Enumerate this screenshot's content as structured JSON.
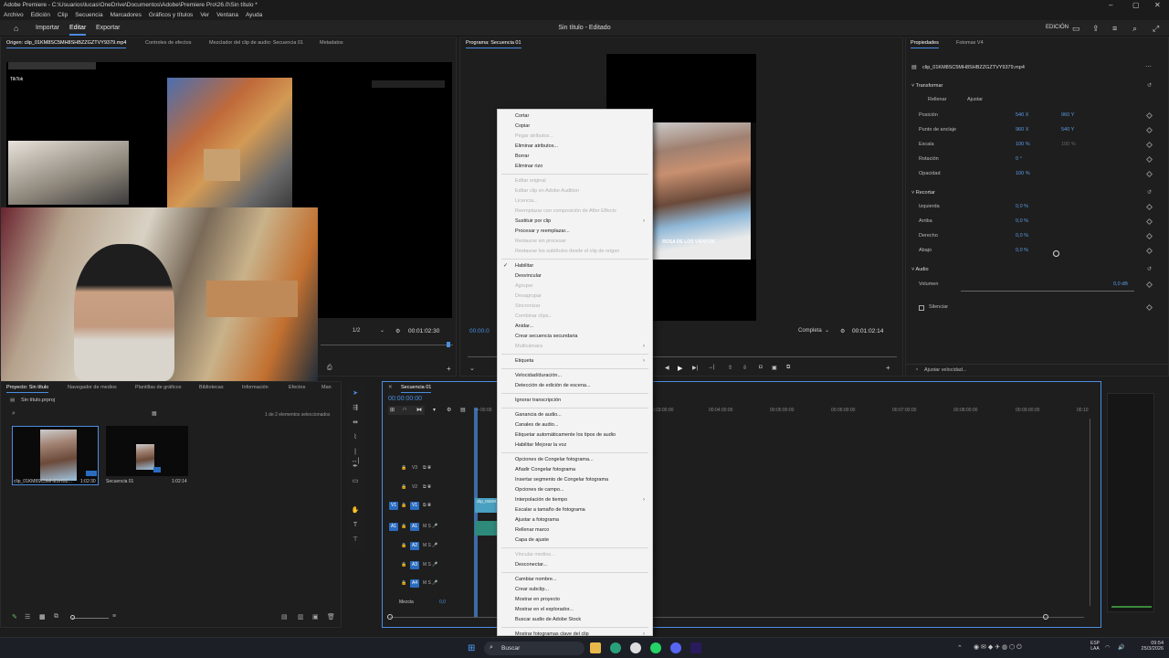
{
  "window": {
    "title": "Adobe Premiere - C:\\Usuarios\\lucas\\OneDrive\\Documentos\\Adobe\\Premiere Pro\\26.0\\Sin título *"
  },
  "menubar": [
    "Archivo",
    "Edición",
    "Clip",
    "Secuencia",
    "Marcadores",
    "Gráficos y títulos",
    "Ver",
    "Ventana",
    "Ayuda"
  ],
  "header": {
    "tabs": [
      "Importar",
      "Editar",
      "Exportar"
    ],
    "active_tab": "Editar",
    "doc_title": "Sin título - Editado",
    "workspace": "EDICIÓN"
  },
  "source_panel": {
    "tabs": [
      "Origen: clip_01KM8SC5MH8SHBZZGZTVY9379.mp4",
      "Controles de efectos",
      "Mezclador del clip de audio: Secuencia 01",
      "Metadatos"
    ],
    "fraction": "1/2",
    "timecode": "00:01:02:30"
  },
  "program_panel": {
    "tab": "Programa: Secuencia 01",
    "timecode_left": "00:00:0",
    "fit": "Completa",
    "timecode_right": "00:01:02:14",
    "frame_caption": "ROSA DE LOS VIENTOS"
  },
  "properties": {
    "tabs": [
      "Propiedades",
      "Fotomax V4"
    ],
    "clip_name": "clip_01KM8SC5MH8SHBZZGZTVY9379.mp4",
    "transform": {
      "title": "Transformar",
      "fill": "Rellenar",
      "fit": "Ajustar",
      "position_label": "Posición",
      "position_x": "540 X",
      "position_y": "960 Y",
      "anchor_label": "Punto de anclaje",
      "anchor_x": "960 X",
      "anchor_y": "540 Y",
      "scale_label": "Escala",
      "scale": "100 %",
      "scale2": "100 %",
      "rotation_label": "Rotación",
      "rotation": "0 °",
      "opacity_label": "Opacidad",
      "opacity": "100 %"
    },
    "crop": {
      "title": "Recortar",
      "left_label": "Izquierda",
      "left": "0,0 %",
      "top_label": "Arriba",
      "top": "0,0 %",
      "right_label": "Derecho",
      "right": "0,0 %",
      "bottom_label": "Abajo",
      "bottom": "0,0 %"
    },
    "audio": {
      "title": "Audio",
      "volume_label": "Volumen",
      "volume": "0,0 dB",
      "mute_label": "Silenciar",
      "volume_level": 0.55
    },
    "speed_button": "Ajustar velocidad..."
  },
  "project_panel": {
    "tabs": [
      "Proyecto: Sin título",
      "Navegador de medios",
      "Plantillas de gráficos",
      "Bibliotecas",
      "Información",
      "Efectos",
      "Man"
    ],
    "project_file": "Sin título.prproj",
    "selection_info": "1 de 2 elementos seleccionados",
    "items": [
      {
        "name": "clip_01KM8SC5MH8SHBZ...",
        "duration": "1:02:30"
      },
      {
        "name": "Secuencia 01",
        "duration": "1:02:14"
      }
    ]
  },
  "timeline": {
    "tab": "Secuencia 01",
    "timecode": "00:00:00:00",
    "ruler": [
      "00:00",
      "00:03:00:00",
      "00:04:00:00",
      "00:05:00:00",
      "00:06:00:00",
      "00:07:00:00",
      "00:08:00:00",
      "00:09:00:00",
      "00:10"
    ],
    "tracks": [
      "V3",
      "V2",
      "V1",
      "A1",
      "A2",
      "A3",
      "A4"
    ],
    "mix_label": "Mezcla",
    "mix_value": "0,0",
    "clip_label": "clip_01KM"
  },
  "context_menu": {
    "items": [
      {
        "label": "Cortar",
        "enabled": true
      },
      {
        "label": "Copiar",
        "enabled": true
      },
      {
        "label": "Pegar atributos...",
        "enabled": false
      },
      {
        "label": "Eliminar atributos...",
        "enabled": true
      },
      {
        "label": "Borrar",
        "enabled": true
      },
      {
        "label": "Eliminar rizo",
        "enabled": true
      },
      {
        "sep": true
      },
      {
        "label": "Editar original",
        "enabled": false
      },
      {
        "label": "Editar clip en Adobe Audition",
        "enabled": false
      },
      {
        "label": "Licencia...",
        "enabled": false
      },
      {
        "label": "Reemplazar con composición de After Effects",
        "enabled": false
      },
      {
        "label": "Sustituir por clip",
        "enabled": true,
        "submenu": true
      },
      {
        "label": "Procesar y reemplazar...",
        "enabled": true
      },
      {
        "label": "Restaurar sin procesar",
        "enabled": false
      },
      {
        "label": "Restaurar los subtítulos desde el clip de origen",
        "enabled": false
      },
      {
        "sep": true
      },
      {
        "label": "Habilitar",
        "enabled": true,
        "checked": true
      },
      {
        "label": "Desvincular",
        "enabled": true,
        "hover": true
      },
      {
        "label": "Agrupar",
        "enabled": false
      },
      {
        "label": "Desagrupar",
        "enabled": false
      },
      {
        "label": "Sincronizar",
        "enabled": false
      },
      {
        "label": "Combinar clips...",
        "enabled": false
      },
      {
        "label": "Anidar...",
        "enabled": true
      },
      {
        "label": "Crear secuencia secundaria",
        "enabled": true
      },
      {
        "label": "Multicámara",
        "enabled": false,
        "submenu": true
      },
      {
        "sep": true
      },
      {
        "label": "Etiqueta",
        "enabled": true,
        "submenu": true
      },
      {
        "sep": true
      },
      {
        "label": "Velocidad/duración...",
        "enabled": true
      },
      {
        "label": "Detección de edición de escena...",
        "enabled": true
      },
      {
        "sep": true
      },
      {
        "label": "Ignorar transcripción",
        "enabled": true
      },
      {
        "sep": true
      },
      {
        "label": "Ganancia de audio...",
        "enabled": true
      },
      {
        "label": "Canales de audio...",
        "enabled": true
      },
      {
        "label": "Etiquetar automáticamente los tipos de audio",
        "enabled": true
      },
      {
        "label": "Habilitar Mejorar la voz",
        "enabled": true
      },
      {
        "sep": true
      },
      {
        "label": "Opciones de Congelar fotograma...",
        "enabled": true
      },
      {
        "label": "Añadir Congelar fotograma",
        "enabled": true
      },
      {
        "label": "Insertar segmento de Congelar fotograma",
        "enabled": true
      },
      {
        "label": "Opciones de campo...",
        "enabled": true
      },
      {
        "label": "Interpolación de tiempo",
        "enabled": true,
        "submenu": true
      },
      {
        "label": "Escalar a tamaño de fotograma",
        "enabled": true
      },
      {
        "label": "Ajustar a fotograma",
        "enabled": true
      },
      {
        "label": "Rellenar marco",
        "enabled": true
      },
      {
        "label": "Capa de ajuste",
        "enabled": true
      },
      {
        "sep": true
      },
      {
        "label": "Vincular medios...",
        "enabled": false
      },
      {
        "label": "Desconectar...",
        "enabled": true
      },
      {
        "sep": true
      },
      {
        "label": "Cambiar nombre...",
        "enabled": true
      },
      {
        "label": "Crear subclip...",
        "enabled": true
      },
      {
        "label": "Mostrar en proyecto",
        "enabled": true
      },
      {
        "label": "Mostrar en el explorador...",
        "enabled": true
      },
      {
        "label": "Buscar audio de Adobe Stock",
        "enabled": true
      },
      {
        "sep": true
      },
      {
        "label": "Mostrar fotogramas clave del clip",
        "enabled": true,
        "submenu": true
      }
    ]
  },
  "taskbar": {
    "search": "Buscar",
    "lang1": "ESP",
    "lang2": "LAA",
    "time": "09:54",
    "date": "25/3/2026"
  },
  "overlay": {
    "tiktok": "TikTok"
  }
}
